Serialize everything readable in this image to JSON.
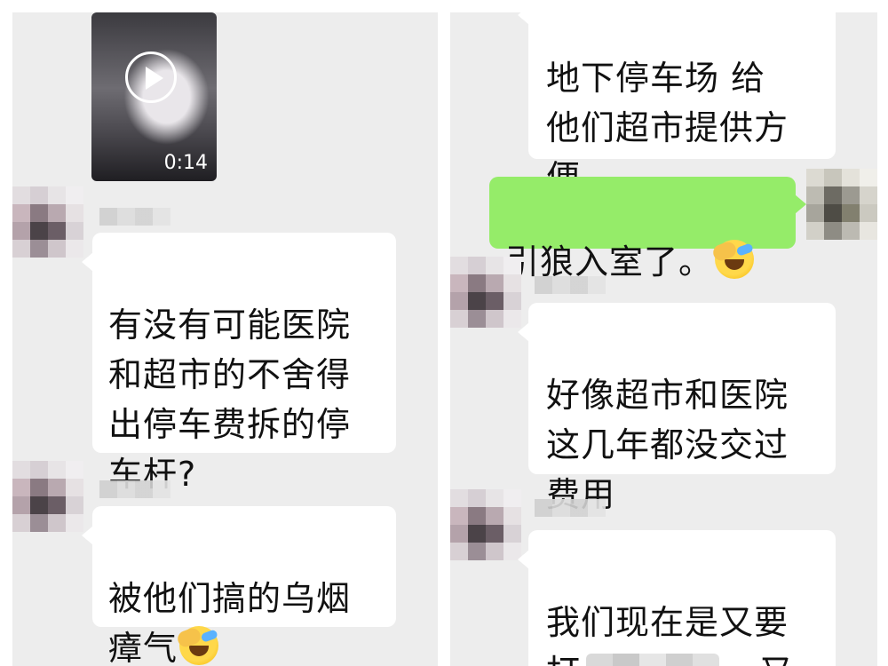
{
  "left_panel": {
    "video": {
      "duration": "0:14"
    },
    "messages": [
      {
        "text": "有没有可能医院\n和超市的不舍得\n出停车费拆的停\n车杆?"
      },
      {
        "text": "被他们搞的乌烟\n瘴气"
      }
    ]
  },
  "right_panel": {
    "messages": [
      {
        "text": "地下停车场   给\n他们超市提供方\n便"
      },
      {
        "text": "引狼入室了。"
      },
      {
        "text": "好像超市和医院\n这几年都没交过\n费用"
      },
      {
        "text_before": "我们现在是又要\n打",
        "text_after": "，又"
      }
    ]
  },
  "colors": {
    "chat_bg": "#ededed",
    "incoming": "#ffffff",
    "outgoing": "#95ec69"
  },
  "icons": {
    "emoji": "facepalm-crying-emoji",
    "play": "play-icon"
  }
}
